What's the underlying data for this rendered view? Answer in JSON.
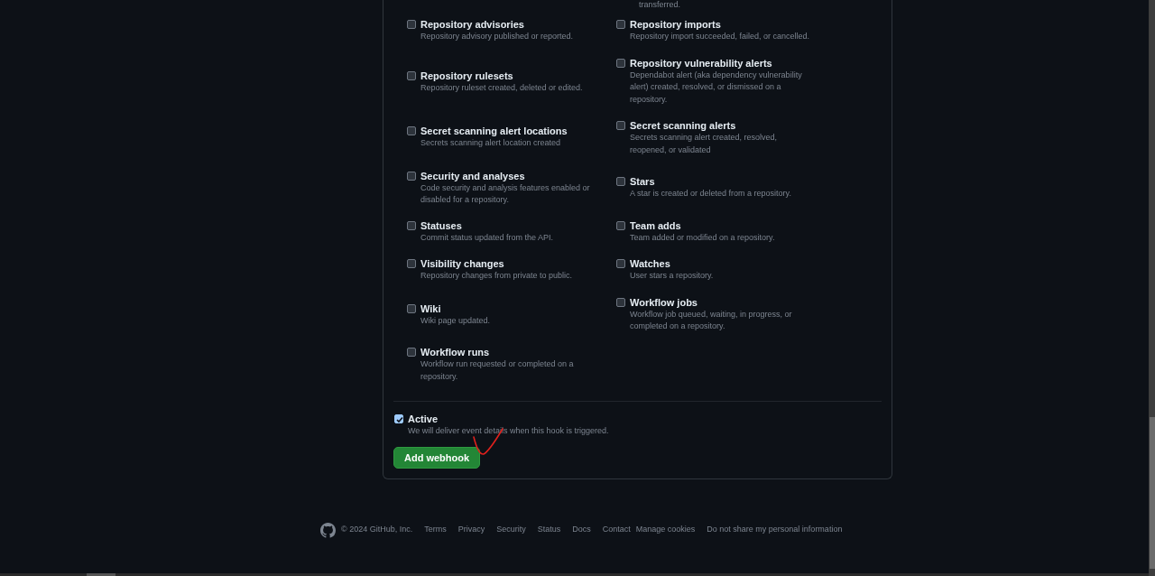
{
  "cut_off_text": "transferred.",
  "events": {
    "columns": [
      [
        {
          "label": "Repository advisories",
          "description": "Repository advisory published or reported.",
          "checked": false
        },
        {
          "label": "Repository rulesets",
          "description": "Repository ruleset created, deleted or edited.",
          "checked": false
        },
        {
          "label": "Secret scanning alert locations",
          "description": "Secrets scanning alert location created",
          "checked": false
        },
        {
          "label": "Security and analyses",
          "description": "Code security and analysis features enabled or disabled for a repository.",
          "checked": false
        },
        {
          "label": "Statuses",
          "description": "Commit status updated from the API.",
          "checked": false
        },
        {
          "label": "Visibility changes",
          "description": "Repository changes from private to public.",
          "checked": false
        },
        {
          "label": "Wiki",
          "description": "Wiki page updated.",
          "checked": false
        },
        {
          "label": "Workflow runs",
          "description": "Workflow run requested or completed on a repository.",
          "checked": false
        }
      ],
      [
        {
          "label": "Repository imports",
          "description": "Repository import succeeded, failed, or cancelled.",
          "checked": false
        },
        {
          "label": "Repository vulnerability alerts",
          "description": "Dependabot alert (aka dependency vulnerability alert) created, resolved, or dismissed on a repository.",
          "checked": false
        },
        {
          "label": "Secret scanning alerts",
          "description": "Secrets scanning alert created, resolved, reopened, or validated",
          "checked": false
        },
        {
          "label": "Stars",
          "description": "A star is created or deleted from a repository.",
          "checked": false
        },
        {
          "label": "Team adds",
          "description": "Team added or modified on a repository.",
          "checked": false
        },
        {
          "label": "Watches",
          "description": "User stars a repository.",
          "checked": false
        },
        {
          "label": "Workflow jobs",
          "description": "Workflow job queued, waiting, in progress, or completed on a repository.",
          "checked": false
        }
      ]
    ]
  },
  "active": {
    "label": "Active",
    "description": "We will deliver event details when this hook is triggered.",
    "checked": true
  },
  "submit_button": "Add webhook",
  "footer": {
    "copyright": "© 2024 GitHub, Inc.",
    "links": [
      "Terms",
      "Privacy",
      "Security",
      "Status",
      "Docs",
      "Contact",
      "Manage cookies",
      "Do not share my personal information"
    ]
  }
}
